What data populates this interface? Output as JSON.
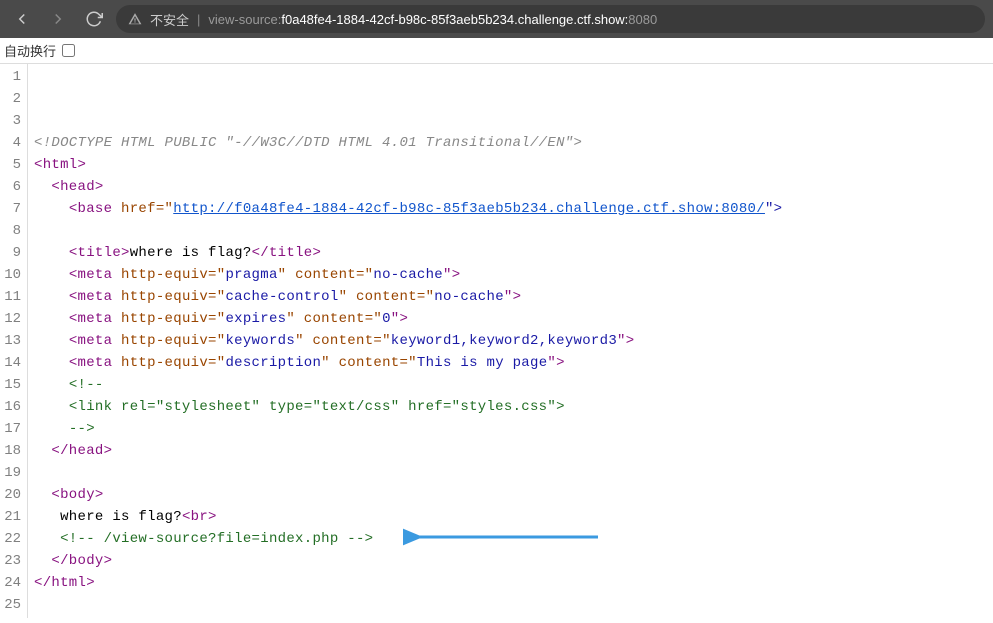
{
  "toolbar": {
    "insecure_label": "不安全",
    "url_prefix": "view-source:",
    "url_main": "f0a48fe4-1884-42cf-b98c-85f3aeb5b234.challenge.ctf.show:",
    "url_port": "8080"
  },
  "sub": {
    "autowrap_label": "自动换行"
  },
  "lines": [
    "1",
    "2",
    "3",
    "4",
    "5",
    "6",
    "7",
    "8",
    "9",
    "10",
    "11",
    "12",
    "13",
    "14",
    "15",
    "16",
    "17",
    "18",
    "19",
    "20",
    "21",
    "22",
    "23",
    "24",
    "25"
  ],
  "src": {
    "doctype": "<!DOCTYPE HTML PUBLIC \"-//W3C//DTD HTML 4.01 Transitional//EN\">",
    "html_open": "<html>",
    "head_open": "<head>",
    "base_tag_open": "<base",
    "base_attr_name": " href=\"",
    "base_href": "http://f0a48fe4-1884-42cf-b98c-85f3aeb5b234.challenge.ctf.show:8080/",
    "base_close": "\">",
    "title_open": "<title>",
    "title_text": "where is flag?",
    "title_close": "</title>",
    "meta_open": "<meta",
    "meta_httpequiv": " http-equiv=\"",
    "meta_content": " content=\"",
    "pragma": "pragma",
    "nocache": "no-cache",
    "cachecontrol": "cache-control",
    "expires": "expires",
    "zero": "0",
    "keywords": "keywords",
    "kw_val": "keyword1,keyword2,keyword3",
    "description": "description",
    "desc_val": "This is my page",
    "close_q_gt": "\">",
    "cmt_open": "<!--",
    "link_line": "<link rel=\"stylesheet\" type=\"text/css\" href=\"styles.css\">",
    "cmt_close": "-->",
    "head_close": "</head>",
    "body_open": "<body>",
    "body_text": "where is flag?",
    "br_tag": "<br>",
    "view_cmt": "<!-- /view-source?file=index.php -->",
    "body_close": "</body>",
    "html_close": "</html>"
  }
}
